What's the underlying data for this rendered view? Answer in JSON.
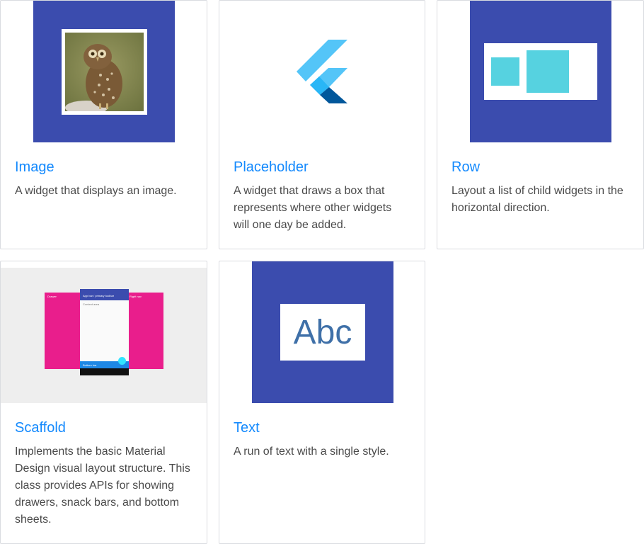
{
  "cards": [
    {
      "title": "Image",
      "description": "A widget that displays an image.",
      "thumbnail_icon": "owl-photo-icon"
    },
    {
      "title": "Placeholder",
      "description": "A widget that draws a box that represents where other widgets will one day be added.",
      "thumbnail_icon": "flutter-logo-icon"
    },
    {
      "title": "Row",
      "description": "Layout a list of child widgets in the horizontal direction.",
      "thumbnail_icon": "row-layout-icon"
    },
    {
      "title": "Scaffold",
      "description": "Implements the basic Material Design visual layout structure. This class provides APIs for showing drawers, snack bars, and bottom sheets.",
      "thumbnail_icon": "scaffold-diagram-icon",
      "diagram": {
        "left_drawer": "Drawer",
        "app_bar": "App bar / primary toolbar",
        "content": "Content area",
        "right_drawer": "Right nav",
        "bottom_bar": "Bottom bar"
      }
    },
    {
      "title": "Text",
      "description": "A run of text with a single style.",
      "thumbnail_icon": "text-sample-icon",
      "sample_text": "Abc"
    }
  ],
  "colors": {
    "accent_link": "#1389fd",
    "thumbnail_blue": "#3b4cae",
    "cyan": "#56d2e0",
    "magenta": "#e91e8c",
    "flutter_light": "#54c5f8",
    "flutter_mid": "#29b6f6",
    "flutter_dark": "#01579b"
  }
}
